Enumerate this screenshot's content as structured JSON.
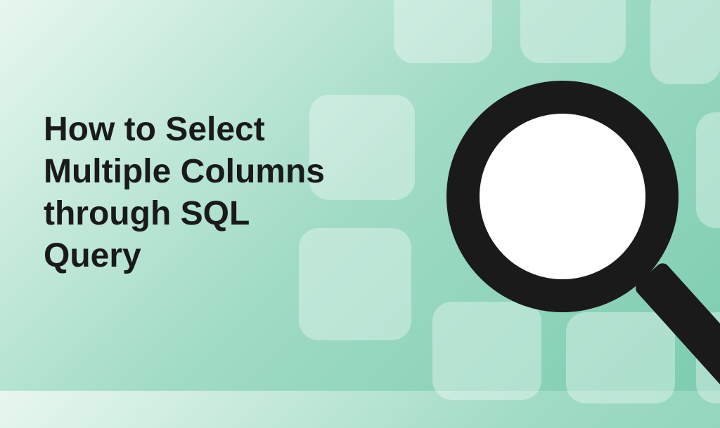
{
  "hero": {
    "title": "How to Select Multiple Columns through SQL Query"
  },
  "colors": {
    "background_start": "#e8f7f0",
    "background_end": "#7dcdb0",
    "text": "#1a1a1a",
    "square_overlay": "rgba(255,255,255,0.35)",
    "magnify_ring": "#1a1a1a",
    "magnify_lens": "#ffffff"
  },
  "icons": {
    "magnify": "magnifying-glass-icon"
  }
}
